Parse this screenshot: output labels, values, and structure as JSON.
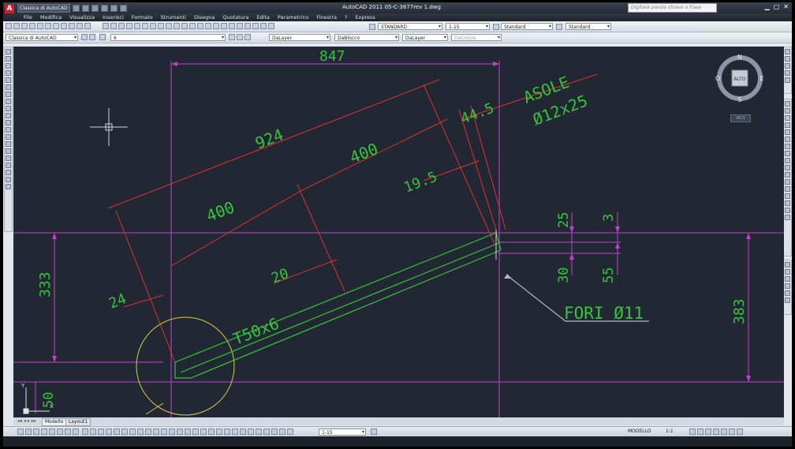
{
  "window": {
    "title": "AutoCAD 2011    05-C-3677rev 1.dwg",
    "workspace": "Classica di AutoCAD",
    "search_placeholder": "Digitare parola chiave o frase",
    "app_logo": "A"
  },
  "menu": [
    "File",
    "Modifica",
    "Visualizza",
    "Inserisci",
    "Formato",
    "Strumenti",
    "Disegna",
    "Quotatura",
    "Edita",
    "Parametrico",
    "Finestra",
    "?",
    "Express"
  ],
  "toolbar": {
    "text_style": "STANDARD",
    "dim_scale": "1-15",
    "dim_style": "Standard",
    "table_style": "Standard",
    "workspace_combo": "Classica di AutoCAD",
    "layer": "6",
    "color": "DaLayer",
    "linetype": "DaBlocco",
    "lineweight": "DaLayer",
    "plotstyle": "DaColore"
  },
  "drawing": {
    "dim_847": "847",
    "dim_924": "924",
    "dim_400_left": "400",
    "dim_400_right": "400",
    "dim_44_5": "44.5",
    "dim_19_5": "19.5",
    "dim_20": "20",
    "dim_24": "24",
    "dim_333": "333",
    "dim_383": "383",
    "dim_25": "25",
    "dim_3": "3",
    "dim_30": "30",
    "dim_55": "55",
    "dim_50": "50",
    "label_asole": "ASOLE",
    "label_asole_size": "Ø12x25",
    "label_profile": "T50x6",
    "label_fori": "FORI Ø11"
  },
  "viewcube": {
    "north": "N",
    "south": "S",
    "east": "E",
    "west": "O",
    "face": "ALTO",
    "wcs": "WCS"
  },
  "ucs": {
    "x": "X",
    "y": "Y"
  },
  "tabs": {
    "model": "Modello",
    "layout1": "Layout1"
  },
  "status": {
    "scale": "1-15",
    "mode": "MODELLO",
    "annotation_scale": "1:1"
  },
  "colors": {
    "dimension_red": "#e03030",
    "text_green": "#35c43a",
    "magenta": "#c040c8",
    "yellow": "#d8c848",
    "background": "#222833"
  }
}
